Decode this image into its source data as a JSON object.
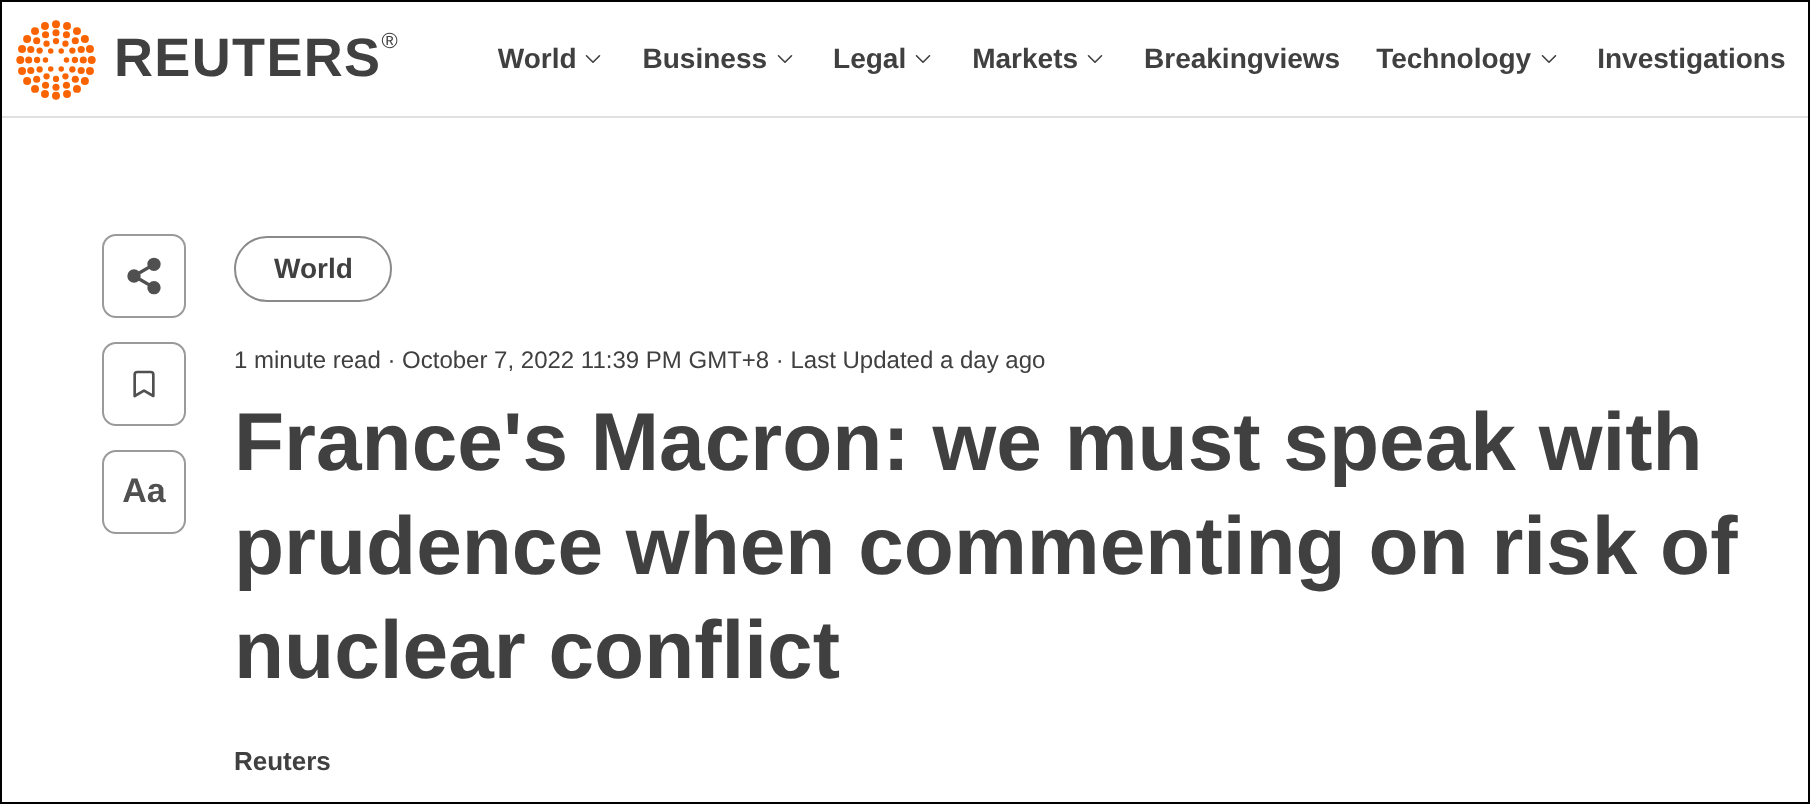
{
  "header": {
    "logo_text": "REUTERS",
    "logo_mark": "®",
    "nav": [
      {
        "label": "World",
        "has_menu": true
      },
      {
        "label": "Business",
        "has_menu": true
      },
      {
        "label": "Legal",
        "has_menu": true
      },
      {
        "label": "Markets",
        "has_menu": true
      },
      {
        "label": "Breakingviews",
        "has_menu": false
      },
      {
        "label": "Technology",
        "has_menu": true
      },
      {
        "label": "Investigations",
        "has_menu": false
      }
    ]
  },
  "side_tools": [
    {
      "kind": "share"
    },
    {
      "kind": "bookmark"
    },
    {
      "kind": "text",
      "label": "Aa"
    }
  ],
  "article": {
    "section": "World",
    "meta": "1 minute read · October 7, 2022 11:39 PM GMT+8 · Last Updated a day ago",
    "headline": "France's Macron: we must speak with prudence when commenting on risk of nuclear conflict",
    "byline": "Reuters"
  }
}
